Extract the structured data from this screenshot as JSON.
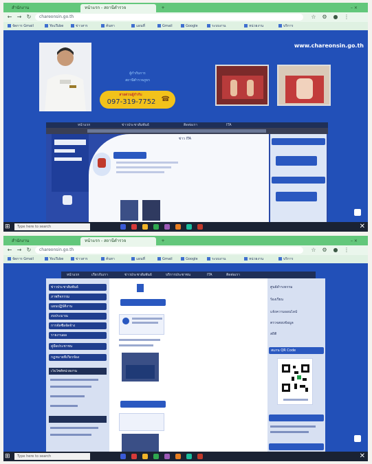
{
  "screenshot_top": {
    "tabs": [
      "สำนักงาน",
      "หน้าแรก - สถานีตำรวจ"
    ],
    "url": "chareonsin.go.th",
    "bookmarks": [
      "จัดการ Gmail",
      "YouTube",
      "ข่าวสาร",
      "ค้นหา",
      "แผนที่",
      "Gmail",
      "Google",
      "ระบบงาน",
      "หน่วยงาน",
      "บริการ"
    ],
    "website": {
      "domain": "www.chareonsin.go.th",
      "person_name": "ผู้กำกับการ",
      "person_title": "สถานีตำรวจภูธร",
      "hotline_label": "สายด่วนผู้กำกับ",
      "hotline_number": "097-319-7752"
    },
    "inner_page": {
      "tabs": [
        "หน้าแรก",
        "ข่าวประชาสัมพันธ์",
        "ติดต่อเรา",
        "ITA"
      ],
      "heading": "ข่าว ITA"
    },
    "taskbar_search": "Type here to search"
  },
  "screenshot_bottom": {
    "tabs": [
      "สำนักงาน",
      "หน้าแรก - สถานีตำรวจ"
    ],
    "url": "chareonsin.go.th",
    "bookmarks": [
      "จัดการ Gmail",
      "YouTube",
      "ข่าวสาร",
      "ค้นหา",
      "แผนที่",
      "Gmail",
      "Google",
      "ระบบงาน",
      "หน่วยงาน",
      "บริการ"
    ],
    "menu_tabs": [
      "หน้าแรก",
      "เกี่ยวกับเรา",
      "ข่าวประชาสัมพันธ์",
      "บริการประชาชน",
      "ITA",
      "ติดต่อเรา"
    ],
    "left_menu": [
      "ข่าวประชาสัมพันธ์",
      "ภาพกิจกรรม",
      "แผนปฏิบัติงาน",
      "งบประมาณ",
      "การจัดซื้อจัดจ้าง",
      "รายงานผล",
      "คู่มือประชาชน",
      "กฎหมายที่เกี่ยวข้อง"
    ],
    "left_section": "เว็บไซต์หน่วยงาน",
    "right_links": [
      "ศูนย์ดำรงธรรม",
      "ร้องเรียน",
      "แจ้งความออนไลน์",
      "ตรวจสอบข้อมูล",
      "สถิติ"
    ],
    "right_section": "สแกน QR Code",
    "taskbar_search": "Type here to search"
  },
  "colors": {
    "brand_blue": "#2250b8",
    "tab_green": "#63c77b",
    "hotline_yellow": "#f2c21b",
    "taskbar": "#1a2233"
  }
}
